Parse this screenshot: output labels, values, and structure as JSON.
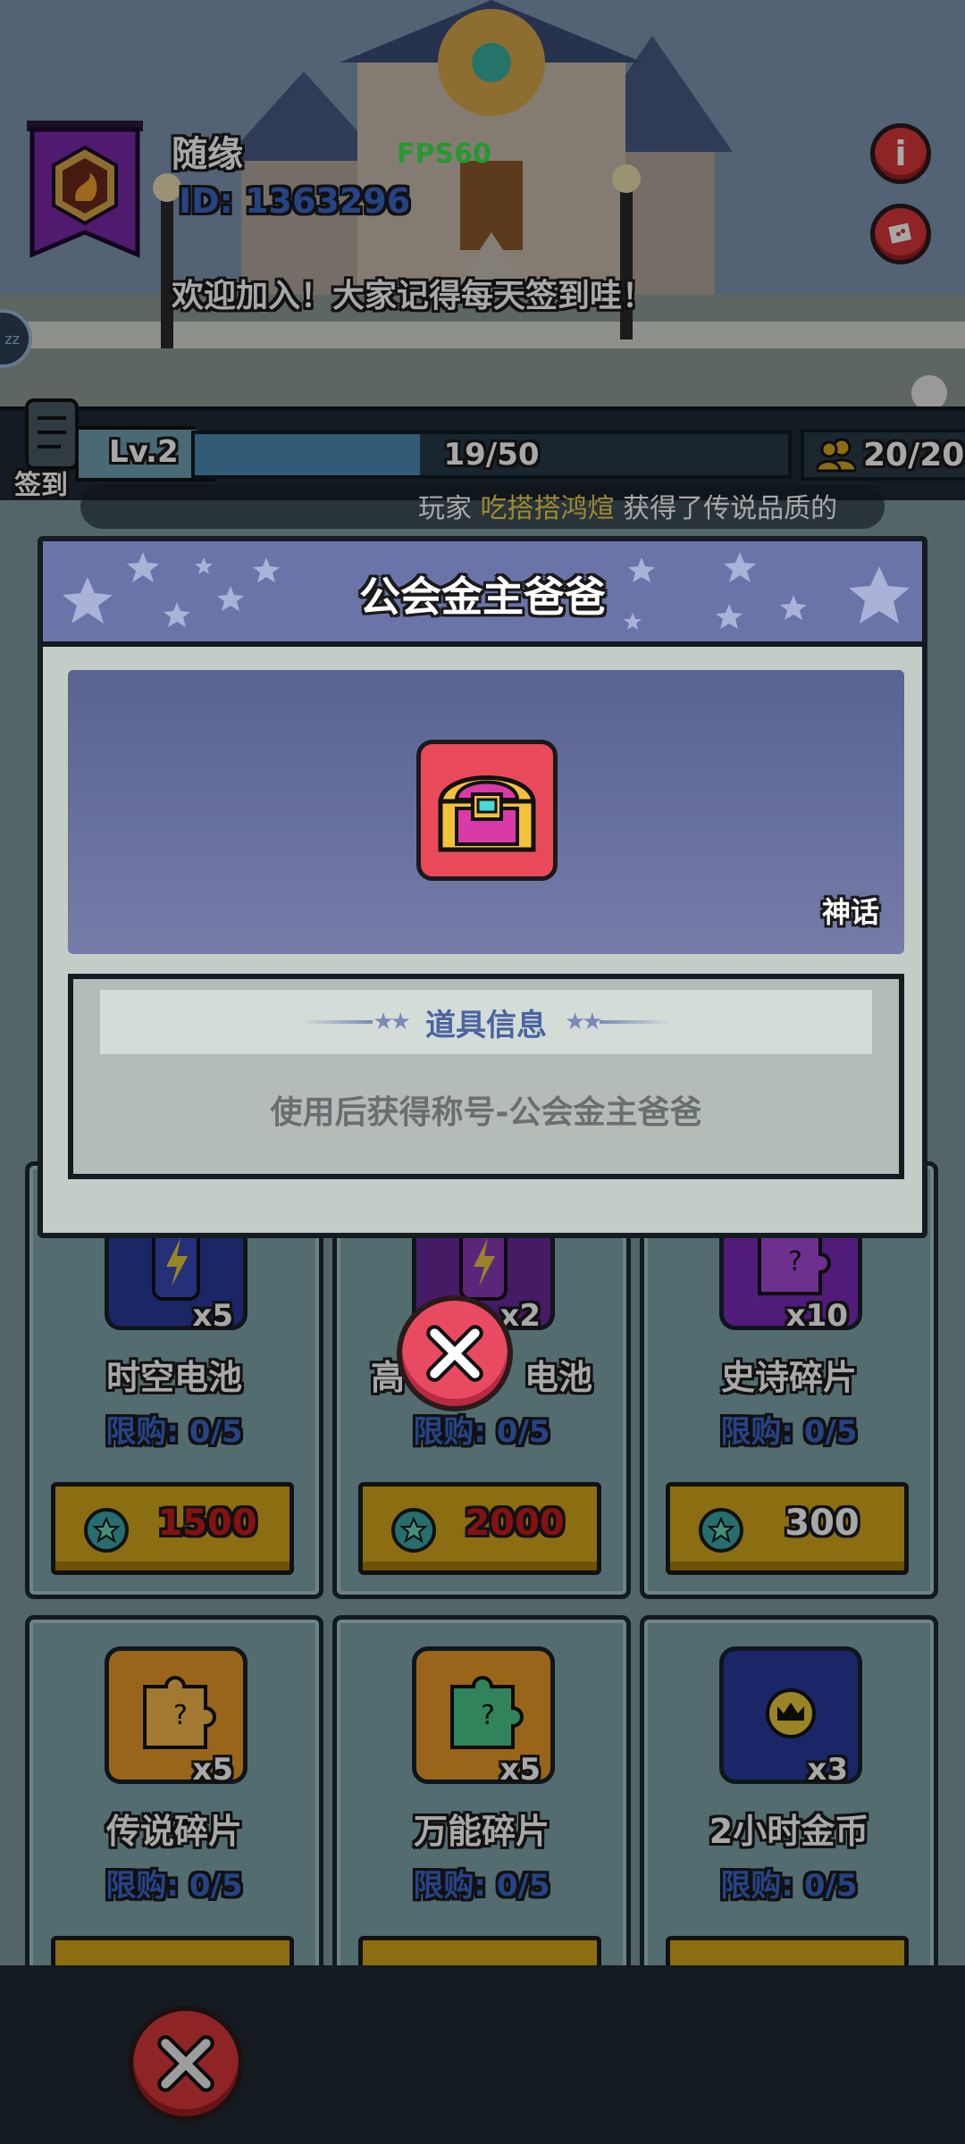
{
  "player": {
    "name": "随缘",
    "id_text": "ID: 1363296",
    "welcome": "欢迎加入！大家记得每天签到哇！"
  },
  "fps_text": "FPS60",
  "status_bar": {
    "signin_label": "签到",
    "level_text": "Lv.2",
    "xp_text": "19/50",
    "xp_fraction": 0.38,
    "members_text": "20/20"
  },
  "ticker": {
    "prefix": "玩家",
    "player": "吃搭搭鸿煊",
    "suffix": "获得了传说品质的"
  },
  "modal": {
    "title": "公会金主爸爸",
    "rarity": "神话",
    "info_title": "道具信息",
    "description": "使用后获得称号-公会金主爸爸"
  },
  "shop": {
    "items": [
      {
        "name": "时空电池",
        "qty": "x5",
        "limit": "限购: 0/5",
        "price": "1500",
        "price_affordable": false,
        "icon": "battery-icon",
        "icon_color": "#2a3a9c"
      },
      {
        "name": "高",
        "name_tail": "电池",
        "qty": "x2",
        "limit": "限购: 0/5",
        "price": "2000",
        "price_affordable": false,
        "icon": "battery-icon",
        "icon_color": "#6a2a9c"
      },
      {
        "name": "史诗碎片",
        "qty": "x10",
        "limit": "限购: 0/5",
        "price": "300",
        "price_affordable": true,
        "icon": "puzzle-piece-icon",
        "icon_color": "#7a2ab8"
      },
      {
        "name": "传说碎片",
        "qty": "x5",
        "limit": "限购: 0/5",
        "icon": "puzzle-piece-icon",
        "icon_color": "#e89a2a"
      },
      {
        "name": "万能碎片",
        "qty": "x5",
        "limit": "限购: 0/5",
        "icon": "puzzle-piece-icon",
        "icon_color": "#e89a2a"
      },
      {
        "name": "2小时金币",
        "qty": "x3",
        "limit": "限购: 0/5",
        "icon": "crown-icon",
        "icon_color": "#2a3aa0"
      }
    ]
  },
  "colors": {
    "modal_header": "#6a74a8",
    "close_button": "#e84a62",
    "price_button": "#d4a61c",
    "fps_green": "#39e84a"
  }
}
